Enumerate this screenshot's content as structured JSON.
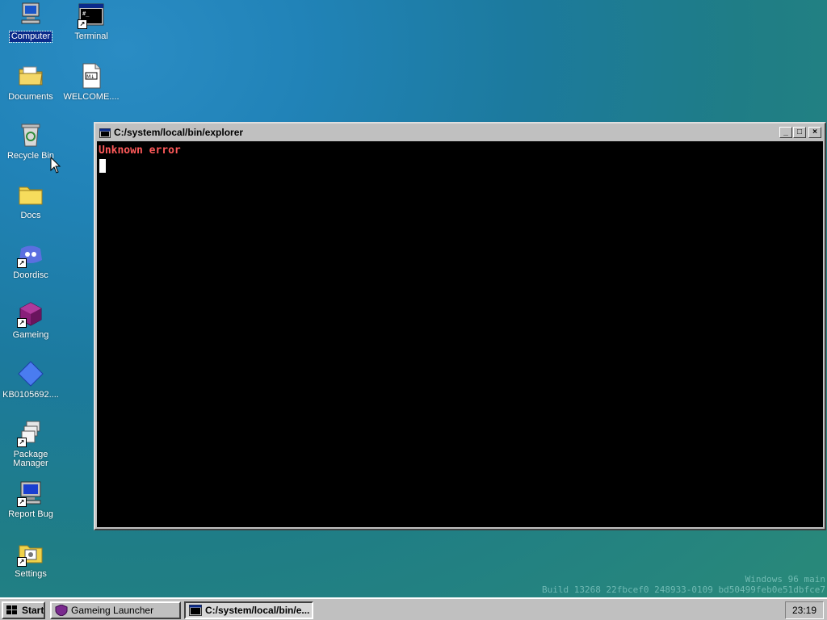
{
  "desktop": {
    "icons": [
      {
        "label": "Computer",
        "icon": "computer-icon",
        "selected": true
      },
      {
        "label": "Terminal",
        "icon": "terminal-icon"
      },
      {
        "label": "Documents",
        "icon": "documents-folder-icon"
      },
      {
        "label": "WELCOME....",
        "icon": "markdown-file-icon"
      },
      {
        "label": "Recycle Bin",
        "icon": "recycle-bin-icon"
      },
      {
        "label": "Docs",
        "icon": "folder-icon"
      },
      {
        "label": "Doordisc",
        "icon": "doordisc-icon"
      },
      {
        "label": "Gameing",
        "icon": "gameing-cube-icon"
      },
      {
        "label": "KB0105692....",
        "icon": "diamond-icon"
      },
      {
        "label": "Package Manager",
        "icon": "package-manager-icon"
      },
      {
        "label": "Report Bug",
        "icon": "report-bug-icon"
      },
      {
        "label": "Settings",
        "icon": "settings-icon"
      }
    ],
    "watermark": {
      "line1": "Windows 96 main",
      "line2": "Build 13268 22fbcef0 248933-0109 bd50499feb0e51dbfce7"
    }
  },
  "window": {
    "title": "C:/system/local/bin/explorer",
    "buttons": {
      "minimize": "_",
      "maximize": "□",
      "close": "×"
    },
    "console": {
      "error_text": "Unknown error"
    }
  },
  "taskbar": {
    "start_label": "Start",
    "tasks": [
      {
        "label": "Gameing Launcher",
        "icon": "gameing-shield-icon",
        "active": false
      },
      {
        "label": "C:/system/local/bin/e...",
        "icon": "terminal-icon",
        "active": true
      }
    ],
    "clock": "23:19"
  },
  "colors": {
    "error_text": "#ff5a5a",
    "console_bg": "#000000",
    "chrome": "#c0c0c0",
    "desktop_teal": "#1f7d86"
  }
}
